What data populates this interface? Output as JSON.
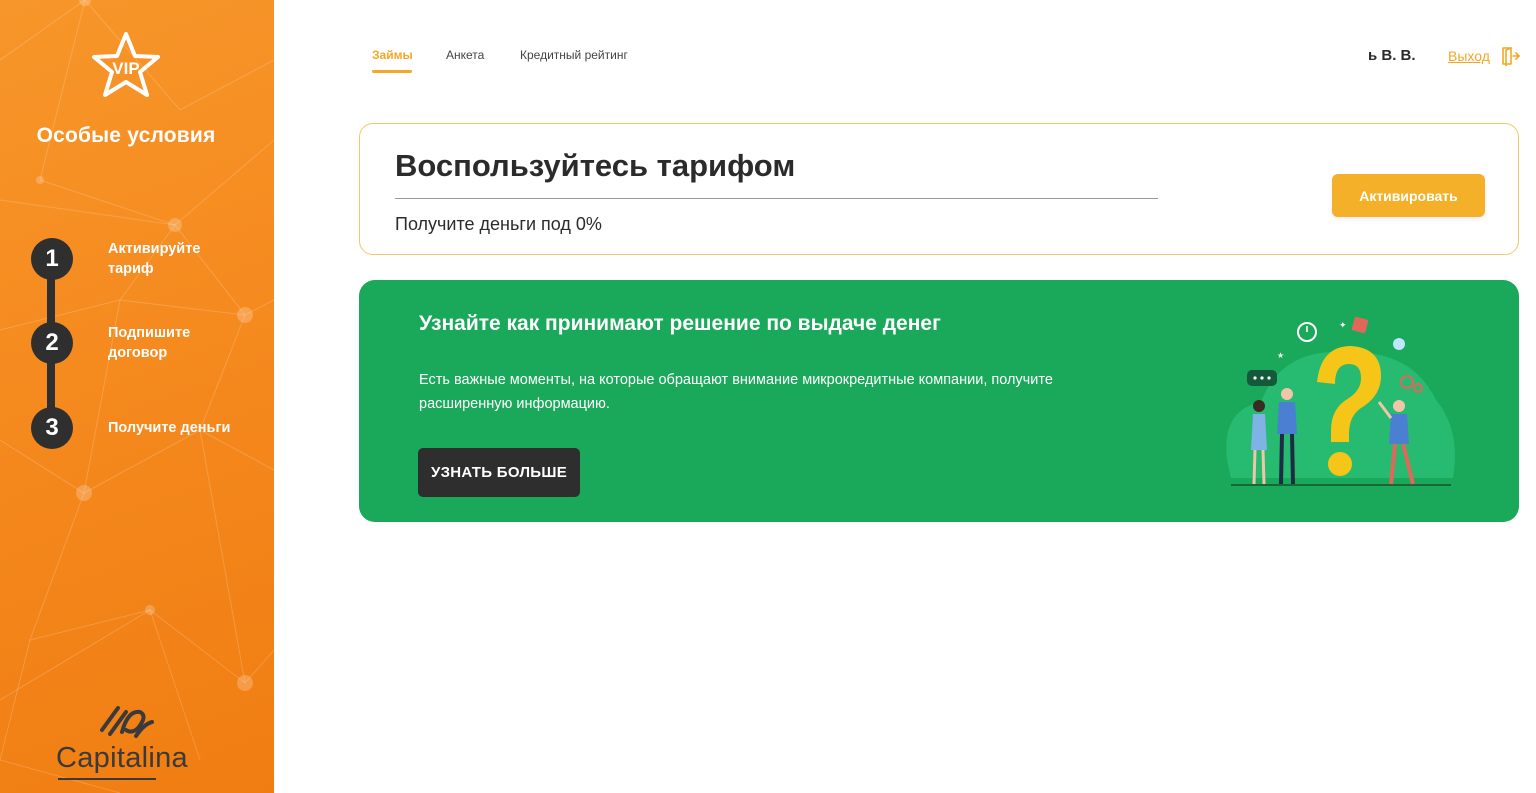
{
  "sidebar": {
    "badge_text": "VIP",
    "title": "Особые условия",
    "steps": [
      {
        "number": "1",
        "label": "Активируйте тариф"
      },
      {
        "number": "2",
        "label": "Подпишите договор"
      },
      {
        "number": "3",
        "label": "Получите деньги"
      }
    ],
    "logo_text": "Capitalina"
  },
  "nav": {
    "tabs": [
      {
        "label": "Займы",
        "active": true
      },
      {
        "label": "Анкета",
        "active": false
      },
      {
        "label": "Кредитный рейтинг",
        "active": false
      }
    ],
    "user_name": "ь В. В.",
    "logout_label": "Выход"
  },
  "tariff": {
    "title": "Воспользуйтесь тарифом",
    "subtitle": "Получите деньги под 0%",
    "activate_label": "Активировать"
  },
  "banner": {
    "title": "Узнайте как принимают решение по выдаче денег",
    "text": "Есть важные моменты, на которые обращают внимание микрокредитные компании, получите расширенную информацию.",
    "button_label": "УЗНАТЬ БОЛЬШЕ"
  },
  "colors": {
    "sidebar_orange": "#f58a1f",
    "accent_yellow": "#f5b02a",
    "banner_green": "#1aa85a",
    "dark": "#2f2f2f"
  }
}
